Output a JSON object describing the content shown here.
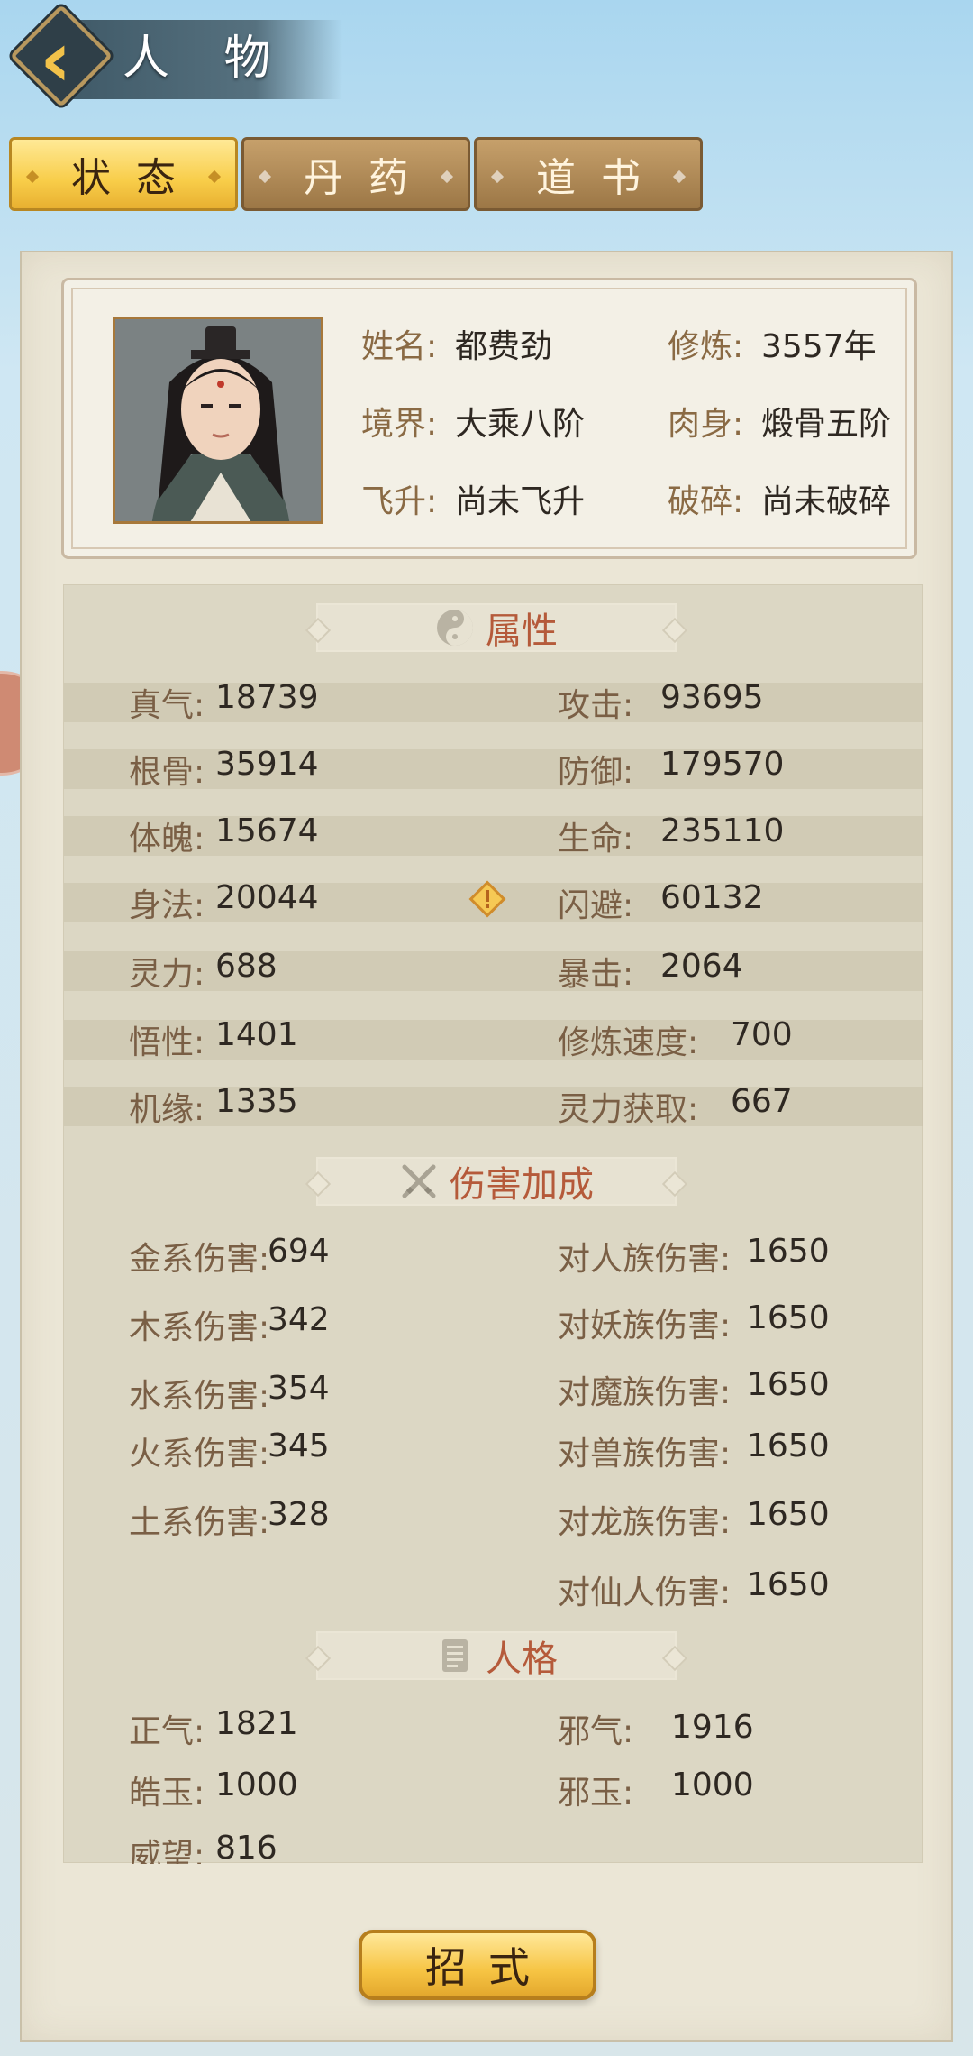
{
  "header": {
    "title": "人 物"
  },
  "tabs": [
    {
      "label": "状态",
      "active": true
    },
    {
      "label": "丹药",
      "active": false
    },
    {
      "label": "道书",
      "active": false
    }
  ],
  "profile": {
    "name_label": "姓名:",
    "name": "都费劲",
    "cultivate_label": "修炼:",
    "cultivate": "3557年",
    "realm_label": "境界:",
    "realm": "大乘八阶",
    "body_label": "肉身:",
    "body": "煅骨五阶",
    "ascend_label": "飞升:",
    "ascend": "尚未飞升",
    "break_label": "破碎:",
    "break": "尚未破碎"
  },
  "attributes": {
    "title": "属性",
    "left": [
      {
        "label": "真气:",
        "value": "18739"
      },
      {
        "label": "根骨:",
        "value": "35914"
      },
      {
        "label": "体魄:",
        "value": "15674"
      },
      {
        "label": "身法:",
        "value": "20044"
      },
      {
        "label": "灵力:",
        "value": "688"
      },
      {
        "label": "悟性:",
        "value": "1401"
      },
      {
        "label": "机缘:",
        "value": "1335"
      }
    ],
    "right": [
      {
        "label": "攻击:",
        "value": "93695"
      },
      {
        "label": "防御:",
        "value": "179570"
      },
      {
        "label": "生命:",
        "value": "235110"
      },
      {
        "label": "闪避:",
        "value": "60132"
      },
      {
        "label": "暴击:",
        "value": "2064"
      },
      {
        "label": "修炼速度:",
        "value": "700"
      },
      {
        "label": "灵力获取:",
        "value": "667"
      }
    ]
  },
  "damage": {
    "title": "伤害加成",
    "left": [
      {
        "label": "金系伤害:",
        "value": "694"
      },
      {
        "label": "木系伤害:",
        "value": "342"
      },
      {
        "label": "水系伤害:",
        "value": "354"
      },
      {
        "label": "火系伤害:",
        "value": "345"
      },
      {
        "label": "土系伤害:",
        "value": "328"
      }
    ],
    "right": [
      {
        "label": "对人族伤害:",
        "value": "1650"
      },
      {
        "label": "对妖族伤害:",
        "value": "1650"
      },
      {
        "label": "对魔族伤害:",
        "value": "1650"
      },
      {
        "label": "对兽族伤害:",
        "value": "1650"
      },
      {
        "label": "对龙族伤害:",
        "value": "1650"
      },
      {
        "label": "对仙人伤害:",
        "value": "1650"
      }
    ]
  },
  "personality": {
    "title": "人格",
    "left": [
      {
        "label": "正气:",
        "value": "1821"
      },
      {
        "label": "皓玉:",
        "value": "1000"
      },
      {
        "label": "威望:",
        "value": "816"
      }
    ],
    "right": [
      {
        "label": "邪气:",
        "value": "1916"
      },
      {
        "label": "邪玉:",
        "value": "1000"
      }
    ]
  },
  "footer": {
    "skill_button": "招式"
  },
  "colors": {
    "accent_gold": "#f8cd49",
    "section_title": "#b55a3a",
    "panel": "#ebe6d6"
  },
  "icons": {
    "back": "chevron-left-icon",
    "attributes": "yin-yang-icon",
    "damage": "crossed-swords-icon",
    "personality": "scroll-icon",
    "warning": "warning-diamond-icon"
  }
}
